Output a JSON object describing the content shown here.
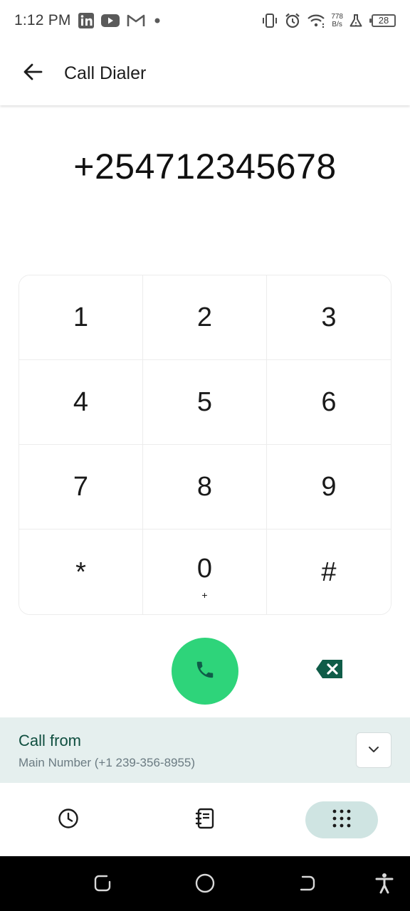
{
  "status_bar": {
    "time": "1:12 PM",
    "left_icons": [
      "linkedin-icon",
      "youtube-icon",
      "gmail-icon",
      "dot-icon"
    ],
    "right_icons": [
      "vibrate-icon",
      "alarm-icon",
      "wifi-icon",
      "flask-icon"
    ],
    "net_speed_value": "778",
    "net_speed_unit": "B/s",
    "battery": "28"
  },
  "app_bar": {
    "title": "Call Dialer",
    "back_icon": "arrow-left-icon"
  },
  "dialer": {
    "number": "+254712345678"
  },
  "keypad": {
    "keys": [
      {
        "digit": "1",
        "sub": ""
      },
      {
        "digit": "2",
        "sub": ""
      },
      {
        "digit": "3",
        "sub": ""
      },
      {
        "digit": "4",
        "sub": ""
      },
      {
        "digit": "5",
        "sub": ""
      },
      {
        "digit": "6",
        "sub": ""
      },
      {
        "digit": "7",
        "sub": ""
      },
      {
        "digit": "8",
        "sub": ""
      },
      {
        "digit": "9",
        "sub": ""
      },
      {
        "digit": "*",
        "sub": ""
      },
      {
        "digit": "0",
        "sub": "+"
      },
      {
        "digit": "#",
        "sub": ""
      }
    ]
  },
  "actions": {
    "call_icon": "phone-icon",
    "backspace_icon": "backspace-icon"
  },
  "call_from": {
    "title": "Call from",
    "number": "Main Number (+1 239-356-8955)"
  },
  "bottom_nav": {
    "items": [
      "recents-clock-icon",
      "contacts-book-icon",
      "keypad-dots-icon"
    ],
    "active": "keypad-dots-icon"
  },
  "colors": {
    "call_green": "#2ed47a",
    "dark_green": "#0f5c48",
    "call_from_bg": "#e5efee",
    "nav_active_bg": "#cfe4e2"
  }
}
